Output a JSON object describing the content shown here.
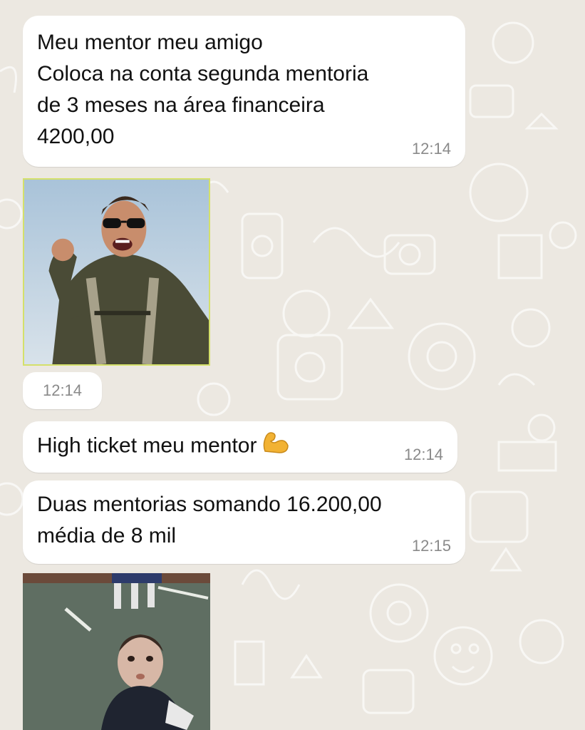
{
  "chat": {
    "messages": [
      {
        "type": "text",
        "text": "Meu mentor meu amigo\nColoca na conta segunda mentoria\nde 3 meses na área financeira\n4200,00",
        "time": "12:14"
      },
      {
        "type": "image",
        "description_icon": "celebrating-pilot-image",
        "time": "12:14"
      },
      {
        "type": "text",
        "text": "High ticket meu mentor",
        "emoji": "flexed-biceps-icon",
        "time": "12:14"
      },
      {
        "type": "text",
        "text": "Duas mentorias somando 16.200,00\nmédia de 8 mil",
        "time": "12:15"
      },
      {
        "type": "image",
        "description_icon": "kid-looking-up-image"
      }
    ]
  },
  "colors": {
    "background": "#ece8e1",
    "bubble": "#ffffff",
    "time": "#8a8a8a",
    "text": "#111111",
    "emoji": "#f2b233"
  }
}
